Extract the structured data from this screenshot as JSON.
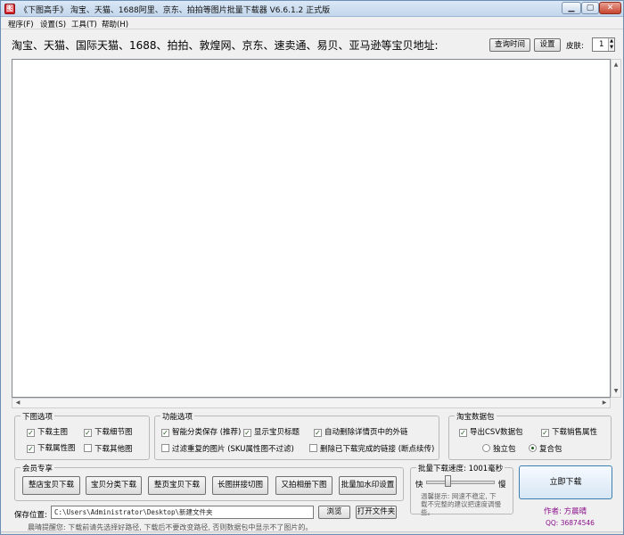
{
  "window": {
    "title": "《下图高手》 淘宝、天猫、1688阿里、京东、拍拍等图片批量下载器 V6.6.1.2 正式版",
    "icon_letter": "图",
    "controls": {
      "minimize": "▁",
      "maximize": "▢",
      "close": "✕"
    }
  },
  "menu": [
    "程序(F)",
    "设置(S)",
    "工具(T)",
    "帮助(H)"
  ],
  "header": {
    "address_label": "淘宝、天猫、国际天猫、1688、拍拍、敦煌网、京东、速卖通、易贝、亚马逊等宝贝地址:",
    "query_time_label": "查询时间",
    "settings_label": "设置",
    "skin_label": "皮肤:",
    "skin_value": "1"
  },
  "main_area": {
    "value": ""
  },
  "download_options": {
    "title": "下图选项",
    "items": [
      {
        "label": "下载主图",
        "checked": true
      },
      {
        "label": "下载细节图",
        "checked": true
      },
      {
        "label": "下载属性图",
        "checked": true
      },
      {
        "label": "下载其他图",
        "checked": false
      }
    ]
  },
  "function_options": {
    "title": "功能选项",
    "items": [
      {
        "label": "智能分类保存 (推荐)",
        "checked": true
      },
      {
        "label": "显示宝贝标题",
        "checked": true
      },
      {
        "label": "自动删除详情页中的外链",
        "checked": true
      },
      {
        "label": "过滤重复的图片 (SKU属性图不过滤)",
        "checked": false
      },
      {
        "label": "删除已下载完成的链接 (断点续传)",
        "checked": false
      }
    ]
  },
  "taobao_package": {
    "title": "淘宝数据包",
    "items": [
      {
        "label": "导出CSV数据包",
        "checked": true
      },
      {
        "label": "下载销售属性",
        "checked": true
      }
    ],
    "radios": [
      {
        "label": "独立包",
        "selected": false
      },
      {
        "label": "复合包",
        "selected": true
      }
    ]
  },
  "member": {
    "title": "会员专享",
    "buttons": [
      "整店宝贝下载",
      "宝贝分类下载",
      "整页宝贝下载",
      "长图拼接切图",
      "又拍相册下图",
      "批量加水印设置"
    ]
  },
  "speed": {
    "title": "批量下载速度: 1001毫秒",
    "fast": "快",
    "slow": "慢",
    "level": 0.3,
    "hint": "温馨提示: 网速不稳定, 下载不完整的建议把速度调慢些。"
  },
  "download_now": "立即下载",
  "author": "作者: 方晨晴",
  "qq": "QQ: 36874546",
  "save": {
    "label": "保存位置:",
    "path": "C:\\Users\\Administrator\\Desktop\\新建文件夹",
    "browse": "浏览",
    "open_folder": "打开文件夹"
  },
  "status": "晨晴提醒您: 下载前请先选择好路径, 下载后不要改变路径, 否则数据包中显示不了图片的。"
}
